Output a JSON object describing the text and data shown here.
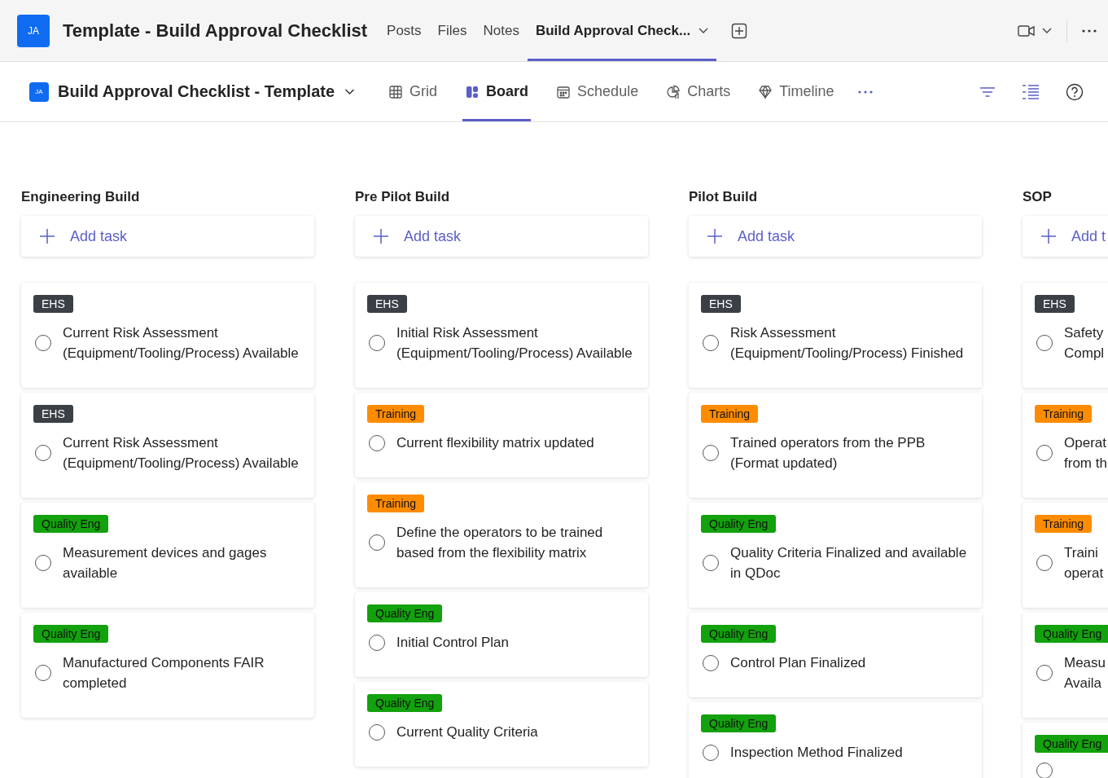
{
  "header": {
    "avatar": "JA",
    "title": "Template - Build Approval Checklist",
    "tabs": [
      {
        "label": "Posts",
        "selected": false
      },
      {
        "label": "Files",
        "selected": false
      },
      {
        "label": "Notes",
        "selected": false
      },
      {
        "label": "Build Approval Check...",
        "selected": true
      }
    ]
  },
  "toolbar": {
    "avatar": "JA",
    "plan_title": "Build Approval Checklist - Template",
    "views": [
      {
        "label": "Grid",
        "selected": false
      },
      {
        "label": "Board",
        "selected": true
      },
      {
        "label": "Schedule",
        "selected": false
      },
      {
        "label": "Charts",
        "selected": false
      },
      {
        "label": "Timeline",
        "selected": false
      }
    ]
  },
  "columns": [
    {
      "name": "Engineering Build",
      "add_task": "Add task",
      "tasks": [
        {
          "tag": "EHS",
          "color": "#3b4046",
          "title": "Current Risk Assessment (Equipment/Tooling/Process) Available",
          "checked": false
        },
        {
          "tag": "EHS",
          "color": "#3b4046",
          "title": "Current Risk Assessment (Equipment/Tooling/Process) Available",
          "checked": false
        },
        {
          "tag": "Quality Eng",
          "color": "#13a10e",
          "title": "Measurement devices and gages available",
          "checked": false
        },
        {
          "tag": "Quality Eng",
          "color": "#13a10e",
          "title": "Manufactured Components FAIR completed",
          "checked": false
        }
      ]
    },
    {
      "name": "Pre Pilot Build",
      "add_task": "Add task",
      "tasks": [
        {
          "tag": "EHS",
          "color": "#3b4046",
          "title": "Initial Risk Assessment (Equipment/Tooling/Process) Available",
          "checked": false
        },
        {
          "tag": "Training",
          "color": "#ff8c00",
          "title": "Current flexibility matrix updated",
          "checked": false
        },
        {
          "tag": "Training",
          "color": "#ff8c00",
          "title": "Define the operators to be trained based from the flexibility matrix",
          "checked": false
        },
        {
          "tag": "Quality Eng",
          "color": "#13a10e",
          "title": "Initial Control Plan",
          "checked": false
        },
        {
          "tag": "Quality Eng",
          "color": "#13a10e",
          "title": "Current Quality Criteria",
          "checked": false
        }
      ]
    },
    {
      "name": "Pilot Build",
      "add_task": "Add task",
      "tasks": [
        {
          "tag": "EHS",
          "color": "#3b4046",
          "title": "Risk Assessment (Equipment/Tooling/Process) Finished",
          "checked": false
        },
        {
          "tag": "Training",
          "color": "#ff8c00",
          "title": "Trained operators from the PPB (Format updated)",
          "checked": false
        },
        {
          "tag": "Quality Eng",
          "color": "#13a10e",
          "title": "Quality Criteria Finalized and available in QDoc",
          "checked": false
        },
        {
          "tag": "Quality Eng",
          "color": "#13a10e",
          "title": "Control Plan Finalized",
          "checked": false
        },
        {
          "tag": "Quality Eng",
          "color": "#13a10e",
          "title": "Inspection Method Finalized",
          "checked": false
        }
      ]
    },
    {
      "name": "SOP",
      "add_task": "Add t",
      "tasks": [
        {
          "tag": "EHS",
          "color": "#3b4046",
          "title": "Safety\nCompl",
          "checked": false
        },
        {
          "tag": "Training",
          "color": "#ff8c00",
          "title": "Operat\nfrom th",
          "checked": false
        },
        {
          "tag": "Training",
          "color": "#ff8c00",
          "title": "Traini\noperat",
          "checked": false
        },
        {
          "tag": "Quality Eng",
          "color": "#13a10e",
          "title": "Measu\nAvaila",
          "checked": false
        },
        {
          "tag": "Quality Eng",
          "color": "#13a10e",
          "checked": false
        }
      ]
    }
  ]
}
